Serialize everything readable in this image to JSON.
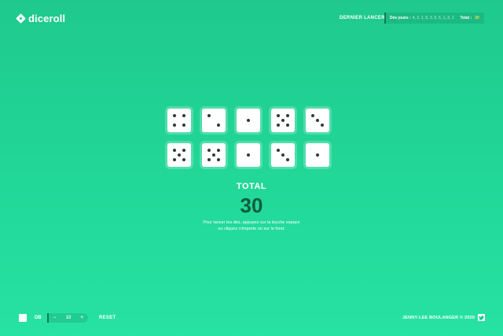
{
  "header": {
    "logo_text": "diceroll",
    "logo_icon": "dice-diamond-icon",
    "last_roll_label": "DERNIER LANCER",
    "history_label": "Dés joués :",
    "history_values": "4, 2, 1, 5, 3, 5, 5, 1, 3, 1",
    "history_total_label": "Total :",
    "history_total_value": "30"
  },
  "dice": [
    4,
    2,
    1,
    5,
    3,
    5,
    5,
    1,
    3,
    1
  ],
  "dice_columns": 5,
  "total": {
    "label": "TOTAL",
    "value": "30"
  },
  "instructions": {
    "line1": "Pour lancer les dés, appuyez sur la touche espace",
    "line2": "ou cliquez n'importe où sur le fond."
  },
  "footer": {
    "db_label": "DB",
    "minus_label": "−",
    "quantity": "10",
    "plus_label": "+",
    "reset_label": "RESET",
    "credit": "JENNY-LEE BOULANGER © 2020",
    "twitter_icon": "twitter-icon"
  },
  "colors": {
    "background_top": "#1fc98e",
    "background_bottom": "#26e2a3",
    "total_value": "#0f5c3e",
    "pip": "#2f3b36",
    "accent": "#ffd84a"
  }
}
